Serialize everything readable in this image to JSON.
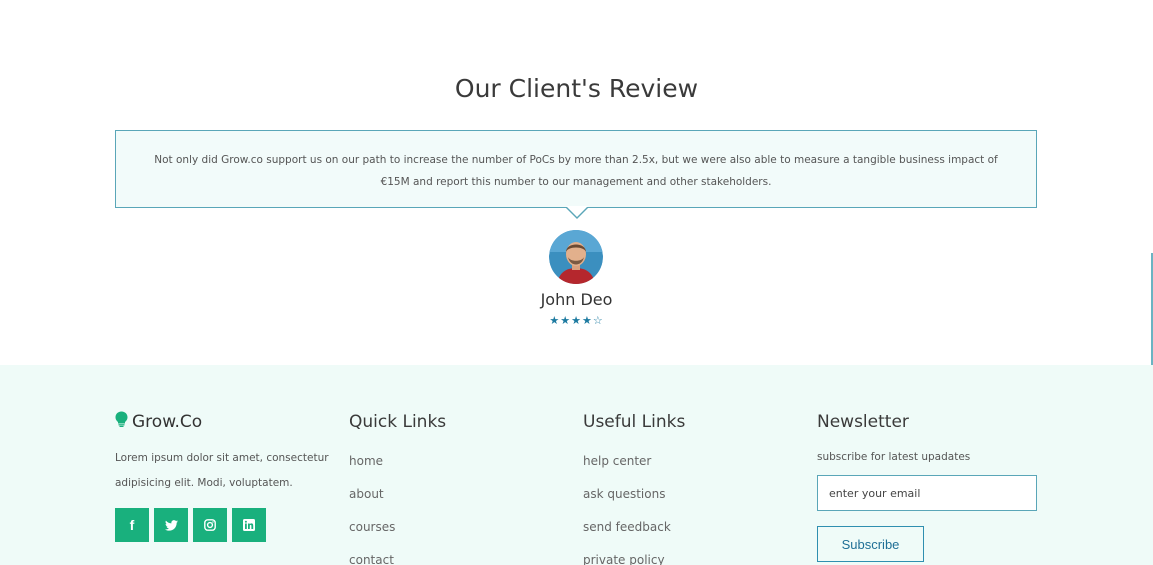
{
  "review": {
    "title": "Our Client's Review",
    "quote": "Not only did Grow.co support us on our path to increase the number of PoCs by more than 2.5x, but we were also able to measure a tangible business impact of €15M and report this number to our management and other stakeholders.",
    "client_name": "John Deo",
    "rating": 4.5,
    "rating_max": 5,
    "star_color": "#1c7aa0"
  },
  "footer": {
    "brand": {
      "name": "Grow.Co",
      "icon": "lightbulb-icon",
      "description": "Lorem ipsum dolor sit amet, consectetur adipisicing elit. Modi, voluptatem.",
      "socials": [
        {
          "icon": "facebook-icon"
        },
        {
          "icon": "twitter-icon"
        },
        {
          "icon": "instagram-icon"
        },
        {
          "icon": "linkedin-icon"
        }
      ],
      "accent": "#19b07d"
    },
    "quick_links": {
      "title": "Quick Links",
      "items": [
        "home",
        "about",
        "courses",
        "contact"
      ]
    },
    "useful_links": {
      "title": "Useful Links",
      "items": [
        "help center",
        "ask questions",
        "send feedback",
        "private policy"
      ]
    },
    "newsletter": {
      "title": "Newsletter",
      "subtitle": "subscribe for latest upadates",
      "email_value": "enter your email",
      "button": "Subscribe"
    },
    "background": "#effbf8"
  }
}
